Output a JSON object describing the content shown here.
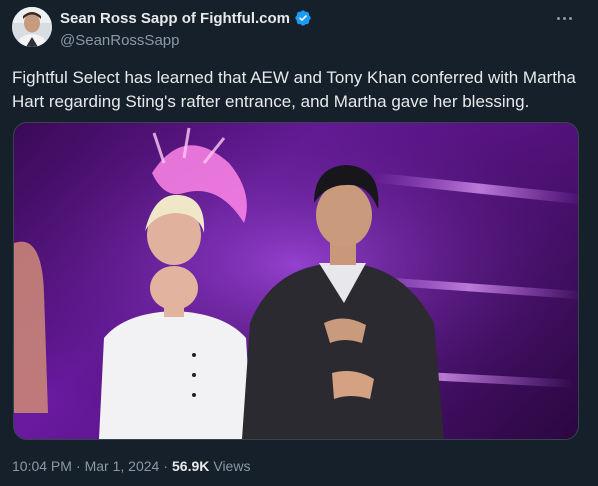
{
  "author": {
    "name": "Sean Ross Sapp of Fightful.com",
    "handle": "@SeanRossSapp"
  },
  "tweet": {
    "line1": "Fightful Select has learned that AEW and Tony Khan conferred with Martha",
    "line2": "Hart regarding Sting's rafter entrance, and Martha gave her blessing."
  },
  "meta": {
    "time": "10:04 PM",
    "separator": "·",
    "date": "Mar 1, 2024",
    "views_count": "56.9K",
    "views_label": "Views"
  },
  "colors": {
    "background": "#15202b",
    "verified": "#1d9bf0",
    "secondary_text": "#8b98a5"
  }
}
